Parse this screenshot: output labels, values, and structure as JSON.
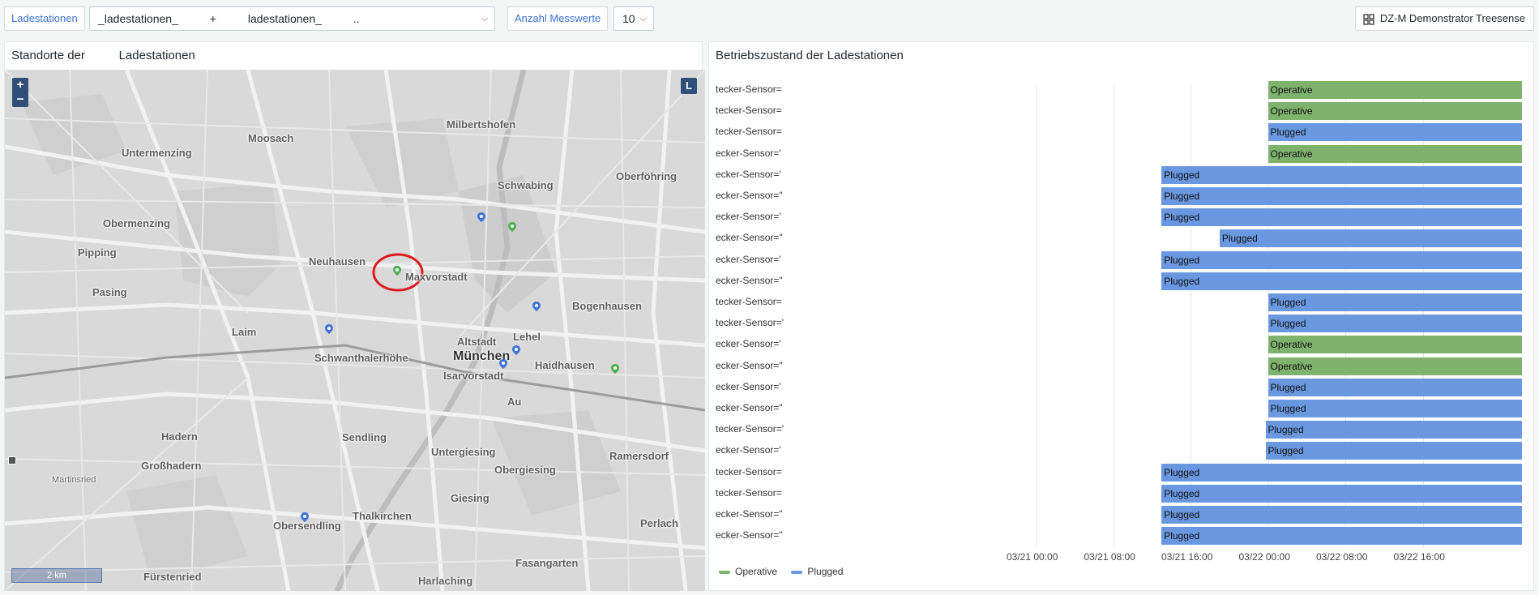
{
  "toolbar": {
    "ladestationen_label": "Ladestationen",
    "ladestationen_value": "_ladestationen_          +          ladestationen_          ..",
    "anzahl_label": "Anzahl Messwerte",
    "anzahl_value": "10",
    "dashboard_button": "DZ-M Demonstrator Treesense"
  },
  "map_panel": {
    "title": "Standorte der          Ladestationen",
    "zoom_in": "+",
    "zoom_out": "−",
    "layer_button": "L",
    "scale_label": "2 km",
    "places": [
      {
        "name": "Milbertshofen",
        "cls": ""
      },
      {
        "name": "Moosach",
        "cls": ""
      },
      {
        "name": "Untermenzing",
        "cls": ""
      },
      {
        "name": "Schwabing",
        "cls": ""
      },
      {
        "name": "Oberföhring",
        "cls": ""
      },
      {
        "name": "Obermenzing",
        "cls": ""
      },
      {
        "name": "Pipping",
        "cls": ""
      },
      {
        "name": "Neuhausen",
        "cls": ""
      },
      {
        "name": "Maxvorstadt",
        "cls": ""
      },
      {
        "name": "Pasing",
        "cls": ""
      },
      {
        "name": "Bogenhausen",
        "cls": ""
      },
      {
        "name": "Laim",
        "cls": ""
      },
      {
        "name": "Altstadt",
        "cls": ""
      },
      {
        "name": "Lehel",
        "cls": ""
      },
      {
        "name": "München",
        "cls": "big"
      },
      {
        "name": "Schwanthalerhöhe",
        "cls": ""
      },
      {
        "name": "Haidhausen",
        "cls": ""
      },
      {
        "name": "Isarvorstadt",
        "cls": ""
      },
      {
        "name": "Au",
        "cls": ""
      },
      {
        "name": "Hadern",
        "cls": ""
      },
      {
        "name": "Sendling",
        "cls": ""
      },
      {
        "name": "Untergiesing",
        "cls": ""
      },
      {
        "name": "Ramersdorf",
        "cls": ""
      },
      {
        "name": "Großhadern",
        "cls": ""
      },
      {
        "name": "Obergiesing",
        "cls": ""
      },
      {
        "name": "Martinsried",
        "cls": "small"
      },
      {
        "name": "Giesing",
        "cls": ""
      },
      {
        "name": "Thalkirchen",
        "cls": ""
      },
      {
        "name": "Perlach",
        "cls": ""
      },
      {
        "name": "Obersendling",
        "cls": ""
      },
      {
        "name": "Fasangarten",
        "cls": ""
      },
      {
        "name": "Fürstenried",
        "cls": ""
      },
      {
        "name": "Harlaching",
        "cls": ""
      }
    ]
  },
  "state_panel": {
    "title": "Betriebszustand der Ladestationen",
    "rows": [
      {
        "label": "tecker-Sensor=",
        "state": "Operative"
      },
      {
        "label": "tecker-Sensor=",
        "state": "Operative"
      },
      {
        "label": "tecker-Sensor=",
        "state": "Plugged"
      },
      {
        "label": "ecker-Sensor='",
        "state": "Operative"
      },
      {
        "label": "ecker-Sensor='",
        "state": "Plugged"
      },
      {
        "label": "ecker-Sensor=\"",
        "state": "Plugged"
      },
      {
        "label": "ecker-Sensor='",
        "state": "Plugged"
      },
      {
        "label": "ecker-Sensor=\"",
        "state": "Plugged"
      },
      {
        "label": "ecker-Sensor='",
        "state": "Plugged"
      },
      {
        "label": "ecker-Sensor=\"",
        "state": "Plugged"
      },
      {
        "label": "tecker-Sensor=",
        "state": "Plugged"
      },
      {
        "label": "tecker-Sensor='",
        "state": "Plugged"
      },
      {
        "label": "ecker-Sensor='",
        "state": "Operative"
      },
      {
        "label": "ecker-Sensor=\"",
        "state": "Operative"
      },
      {
        "label": "ecker-Sensor='",
        "state": "Plugged"
      },
      {
        "label": "ecker-Sensor=\"",
        "state": "Plugged"
      },
      {
        "label": "tecker-Sensor='",
        "state": "Plugged"
      },
      {
        "label": "ecker-Sensor='",
        "state": "Plugged"
      },
      {
        "label": "tecker-Sensor=",
        "state": "Plugged"
      },
      {
        "label": "tecker-Sensor=",
        "state": "Plugged"
      },
      {
        "label": "ecker-Sensor=\"",
        "state": "Plugged"
      },
      {
        "label": "ecker-Sensor=\"",
        "state": "Plugged"
      }
    ],
    "x_ticks": [
      "03/21 00:00",
      "03/21 08:00",
      "03/21 16:00",
      "03/22 00:00",
      "03/22 08:00",
      "03/22 16:00"
    ],
    "legend": [
      {
        "label": "Operative",
        "color": "#7eb26d"
      },
      {
        "label": "Plugged",
        "color": "#6a98e0"
      }
    ],
    "colors": {
      "Operative": "#7eb26d",
      "Plugged": "#6a98e0"
    }
  },
  "chart_data": {
    "type": "state-timeline",
    "title": "Betriebszustand der Ladestationen",
    "x_ticks": [
      "03/21 00:00",
      "03/21 08:00",
      "03/21 16:00",
      "03/22 00:00",
      "03/22 08:00",
      "03/22 16:00"
    ],
    "series": [
      {
        "name": "tecker-Sensor=",
        "start": "03/22 00:00",
        "state": "Operative"
      },
      {
        "name": "tecker-Sensor=",
        "start": "03/22 00:00",
        "state": "Operative"
      },
      {
        "name": "tecker-Sensor=",
        "start": "03/22 00:00",
        "state": "Plugged"
      },
      {
        "name": "ecker-Sensor='",
        "start": "03/22 00:00",
        "state": "Operative"
      },
      {
        "name": "ecker-Sensor='",
        "start": "03/21 13:00",
        "state": "Plugged"
      },
      {
        "name": "ecker-Sensor=\"",
        "start": "03/21 13:00",
        "state": "Plugged"
      },
      {
        "name": "ecker-Sensor='",
        "start": "03/21 13:00",
        "state": "Plugged"
      },
      {
        "name": "ecker-Sensor=\"",
        "start": "03/21 19:00",
        "state": "Plugged"
      },
      {
        "name": "ecker-Sensor='",
        "start": "03/21 13:00",
        "state": "Plugged"
      },
      {
        "name": "ecker-Sensor=\"",
        "start": "03/21 13:00",
        "state": "Plugged"
      },
      {
        "name": "tecker-Sensor=",
        "start": "03/22 00:00",
        "state": "Plugged"
      },
      {
        "name": "tecker-Sensor='",
        "start": "03/22 00:00",
        "state": "Plugged"
      },
      {
        "name": "ecker-Sensor='",
        "start": "03/22 00:00",
        "state": "Operative"
      },
      {
        "name": "ecker-Sensor=\"",
        "start": "03/22 00:00",
        "state": "Operative"
      },
      {
        "name": "ecker-Sensor='",
        "start": "03/22 00:00",
        "state": "Plugged"
      },
      {
        "name": "ecker-Sensor=\"",
        "start": "03/22 00:00",
        "state": "Plugged"
      },
      {
        "name": "tecker-Sensor='",
        "start": "03/21 23:45",
        "state": "Plugged"
      },
      {
        "name": "ecker-Sensor='",
        "start": "03/21 23:45",
        "state": "Plugged"
      },
      {
        "name": "tecker-Sensor=",
        "start": "03/21 13:00",
        "state": "Plugged"
      },
      {
        "name": "tecker-Sensor=",
        "start": "03/21 13:00",
        "state": "Plugged"
      },
      {
        "name": "ecker-Sensor=\"",
        "start": "03/21 13:00",
        "state": "Plugged"
      },
      {
        "name": "ecker-Sensor=\"",
        "start": "03/21 13:00",
        "state": "Plugged"
      }
    ]
  }
}
